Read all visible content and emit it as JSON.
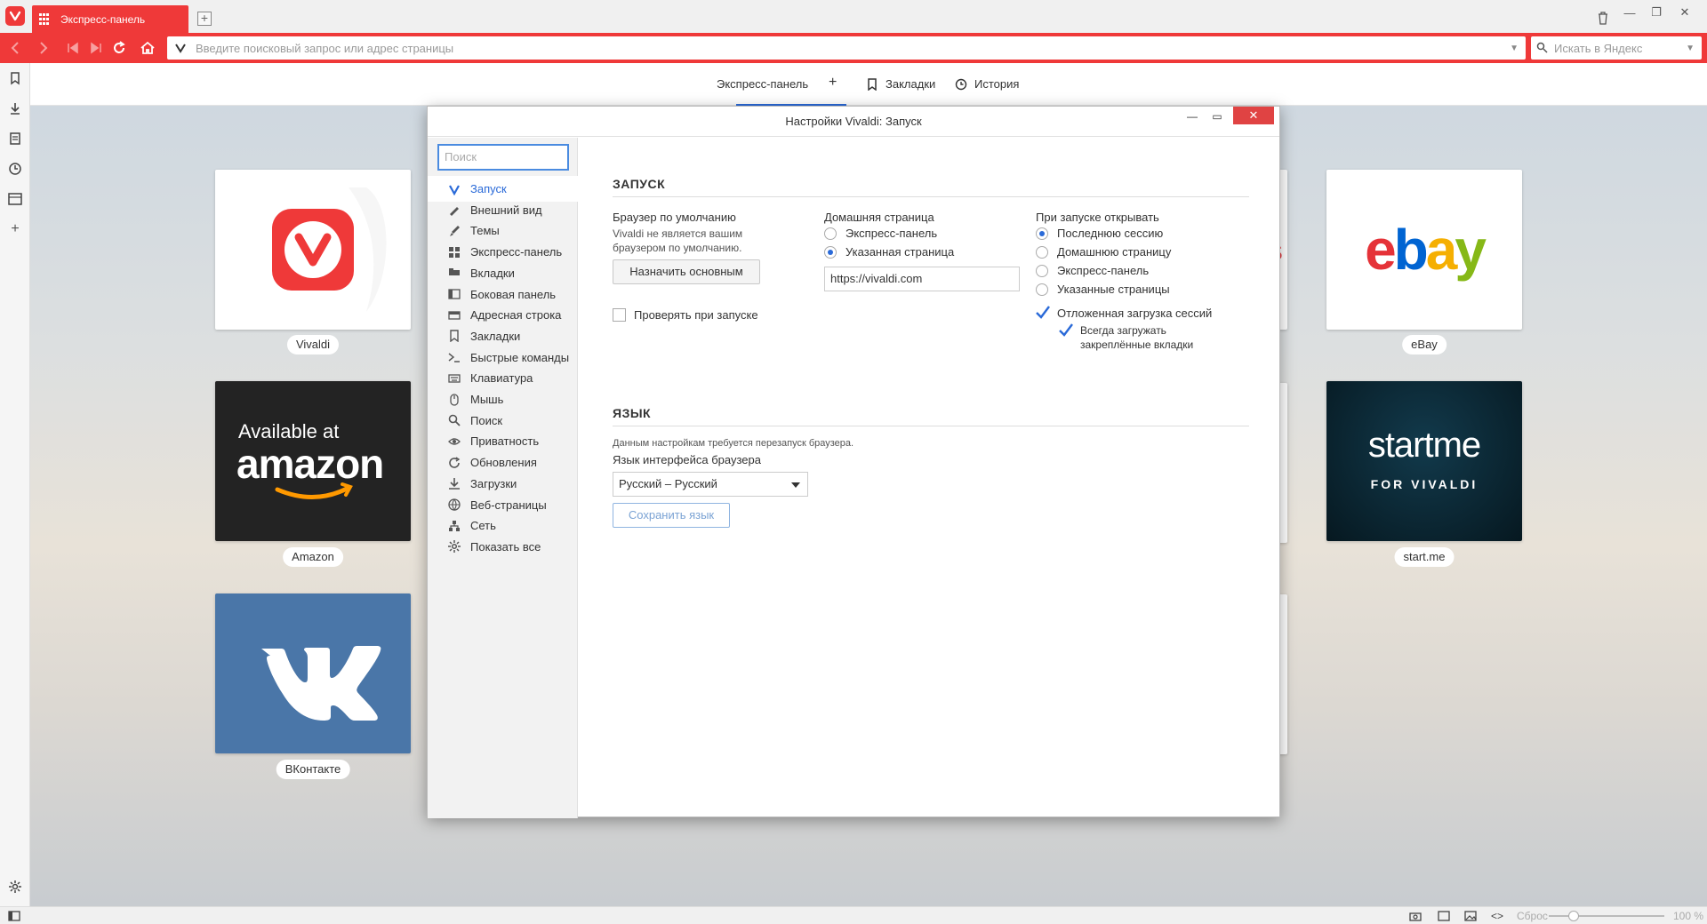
{
  "browser": {
    "tab_title": "Экспресс-панель",
    "address_placeholder": "Введите поисковый запрос или адрес страницы",
    "search_placeholder": "Искать в Яндекс",
    "accent_color": "#ef3939"
  },
  "speed_dial_header": {
    "items": [
      "Экспресс-панель",
      "Закладки",
      "История"
    ]
  },
  "tiles": [
    {
      "label": "Vivaldi"
    },
    {
      "label": "eBay",
      "logo_text": "ebay"
    },
    {
      "label": "Amazon",
      "logo_line1": "Available at",
      "logo_line2": "amazon"
    },
    {
      "label": "start.me",
      "logo_line1": "startme",
      "logo_line2": "FOR VIVALDI"
    },
    {
      "label": "ВКонтакте"
    }
  ],
  "settings": {
    "title": "Настройки Vivaldi: Запуск",
    "search_placeholder": "Поиск",
    "sidebar": [
      {
        "label": "Запуск",
        "icon": "vivaldi-icon",
        "active": true
      },
      {
        "label": "Внешний вид",
        "icon": "appearance-icon"
      },
      {
        "label": "Темы",
        "icon": "brush-icon"
      },
      {
        "label": "Экспресс-панель",
        "icon": "grid-icon"
      },
      {
        "label": "Вкладки",
        "icon": "tabs-icon"
      },
      {
        "label": "Боковая панель",
        "icon": "panel-icon"
      },
      {
        "label": "Адресная строка",
        "icon": "address-bar-icon"
      },
      {
        "label": "Закладки",
        "icon": "bookmark-icon"
      },
      {
        "label": "Быстрые команды",
        "icon": "command-icon"
      },
      {
        "label": "Клавиатура",
        "icon": "keyboard-icon"
      },
      {
        "label": "Мышь",
        "icon": "mouse-icon"
      },
      {
        "label": "Поиск",
        "icon": "search-icon"
      },
      {
        "label": "Приватность",
        "icon": "eye-icon"
      },
      {
        "label": "Обновления",
        "icon": "refresh-icon"
      },
      {
        "label": "Загрузки",
        "icon": "download-icon"
      },
      {
        "label": "Веб-страницы",
        "icon": "globe-icon"
      },
      {
        "label": "Сеть",
        "icon": "network-icon"
      },
      {
        "label": "Показать все",
        "icon": "gear-icon"
      }
    ],
    "startup": {
      "section_title": "ЗАПУСК",
      "default_browser": {
        "heading": "Браузер по умолчанию",
        "note_line1": "Vivaldi не является вашим",
        "note_line2": "браузером по умолчанию.",
        "button": "Назначить основным",
        "check_label": "Проверять при запуске",
        "checked": false
      },
      "homepage": {
        "heading": "Домашняя страница",
        "options": [
          "Экспресс-панель",
          "Указанная страница"
        ],
        "selected": 1,
        "url": "https://vivaldi.com"
      },
      "on_start": {
        "heading": "При запуске открывать",
        "options": [
          "Последнюю сессию",
          "Домашнюю страницу",
          "Экспресс-панель",
          "Указанные страницы"
        ],
        "selected": 0,
        "lazy_load_label": "Отложенная загрузка сессий",
        "lazy_load_checked": true,
        "pinned_label_line1": "Всегда загружать",
        "pinned_label_line2": "закреплённые вкладки",
        "pinned_checked": true
      }
    },
    "language": {
      "section_title": "ЯЗЫК",
      "note": "Данным настройкам требуется перезапуск браузера.",
      "heading": "Язык интерфейса браузера",
      "selected": "Русский – Русский",
      "save_button": "Сохранить язык"
    }
  },
  "statusbar": {
    "reset_label": "Сброс",
    "zoom": "100 %"
  }
}
